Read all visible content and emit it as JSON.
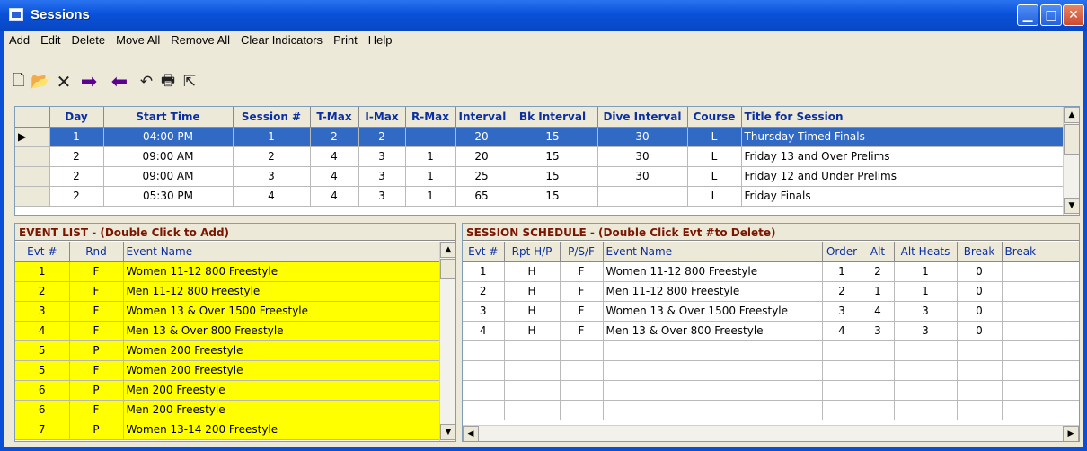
{
  "window": {
    "title": "Sessions"
  },
  "menu": [
    "Add",
    "Edit",
    "Delete",
    "Move All",
    "Remove All",
    "Clear Indicators",
    "Print",
    "Help"
  ],
  "toolbar": [
    "new-icon",
    "open-folder-icon",
    "delete-x-icon",
    "move-right-arrow-icon",
    "move-left-arrow-icon",
    "undo-icon",
    "print-icon",
    "export-icon"
  ],
  "sessions": {
    "columns": [
      "Day",
      "Start Time",
      "Session #",
      "T-Max",
      "I-Max",
      "R-Max",
      "Interval",
      "Bk Interval",
      "Dive Interval",
      "Course",
      "Title for Session"
    ],
    "rows": [
      {
        "day": "1",
        "start": "04:00 PM",
        "session": "1",
        "tmax": "2",
        "imax": "2",
        "rmax": "",
        "interval": "20",
        "bk": "15",
        "dive": "30",
        "course": "L",
        "title": "Thursday Timed Finals"
      },
      {
        "day": "2",
        "start": "09:00 AM",
        "session": "2",
        "tmax": "4",
        "imax": "3",
        "rmax": "1",
        "interval": "20",
        "bk": "15",
        "dive": "30",
        "course": "L",
        "title": "Friday 13 and Over Prelims"
      },
      {
        "day": "2",
        "start": "09:00 AM",
        "session": "3",
        "tmax": "4",
        "imax": "3",
        "rmax": "1",
        "interval": "25",
        "bk": "15",
        "dive": "30",
        "course": "L",
        "title": "Friday 12 and Under Prelims"
      },
      {
        "day": "2",
        "start": "05:30 PM",
        "session": "4",
        "tmax": "4",
        "imax": "3",
        "rmax": "1",
        "interval": "65",
        "bk": "15",
        "dive": "",
        "course": "L",
        "title": "Friday Finals"
      }
    ]
  },
  "event_list": {
    "heading": "EVENT LIST - (Double Click to Add)",
    "columns": [
      "Evt #",
      "Rnd",
      "Event Name"
    ],
    "rows": [
      {
        "evt": "1",
        "rnd": "F",
        "name": "Women 11-12 800 Freestyle"
      },
      {
        "evt": "2",
        "rnd": "F",
        "name": "Men 11-12 800 Freestyle"
      },
      {
        "evt": "3",
        "rnd": "F",
        "name": "Women 13 & Over 1500 Freestyle"
      },
      {
        "evt": "4",
        "rnd": "F",
        "name": "Men 13 & Over 800 Freestyle"
      },
      {
        "evt": "5",
        "rnd": "P",
        "name": "Women 200 Freestyle"
      },
      {
        "evt": "5",
        "rnd": "F",
        "name": "Women 200 Freestyle"
      },
      {
        "evt": "6",
        "rnd": "P",
        "name": "Men 200 Freestyle"
      },
      {
        "evt": "6",
        "rnd": "F",
        "name": "Men 200 Freestyle"
      },
      {
        "evt": "7",
        "rnd": "P",
        "name": "Women 13-14 200 Freestyle"
      }
    ]
  },
  "schedule": {
    "heading": "SESSION SCHEDULE - (Double Click Evt #to Delete)",
    "columns": [
      "Evt #",
      "Rpt H/P",
      "P/S/F",
      "Event Name",
      "Order",
      "Alt",
      "Alt Heats",
      "Break",
      "Break"
    ],
    "rows": [
      {
        "evt": "1",
        "rpt": "H",
        "psf": "F",
        "name": "Women 11-12 800 Freestyle",
        "order": "1",
        "alt": "2",
        "altheats": "1",
        "brk": "0"
      },
      {
        "evt": "2",
        "rpt": "H",
        "psf": "F",
        "name": "Men 11-12 800 Freestyle",
        "order": "2",
        "alt": "1",
        "altheats": "1",
        "brk": "0"
      },
      {
        "evt": "3",
        "rpt": "H",
        "psf": "F",
        "name": "Women 13 & Over 1500 Freestyle",
        "order": "3",
        "alt": "4",
        "altheats": "3",
        "brk": "0"
      },
      {
        "evt": "4",
        "rpt": "H",
        "psf": "F",
        "name": "Men 13 & Over 800 Freestyle",
        "order": "4",
        "alt": "3",
        "altheats": "3",
        "brk": "0"
      }
    ],
    "empty_rows": 5
  },
  "colors": {
    "titlebar": "#0a52d9",
    "selection": "#316ac5",
    "highlight": "#ffff00",
    "header_text": "#0b2fa0",
    "panel_head_text": "#7a1500"
  }
}
